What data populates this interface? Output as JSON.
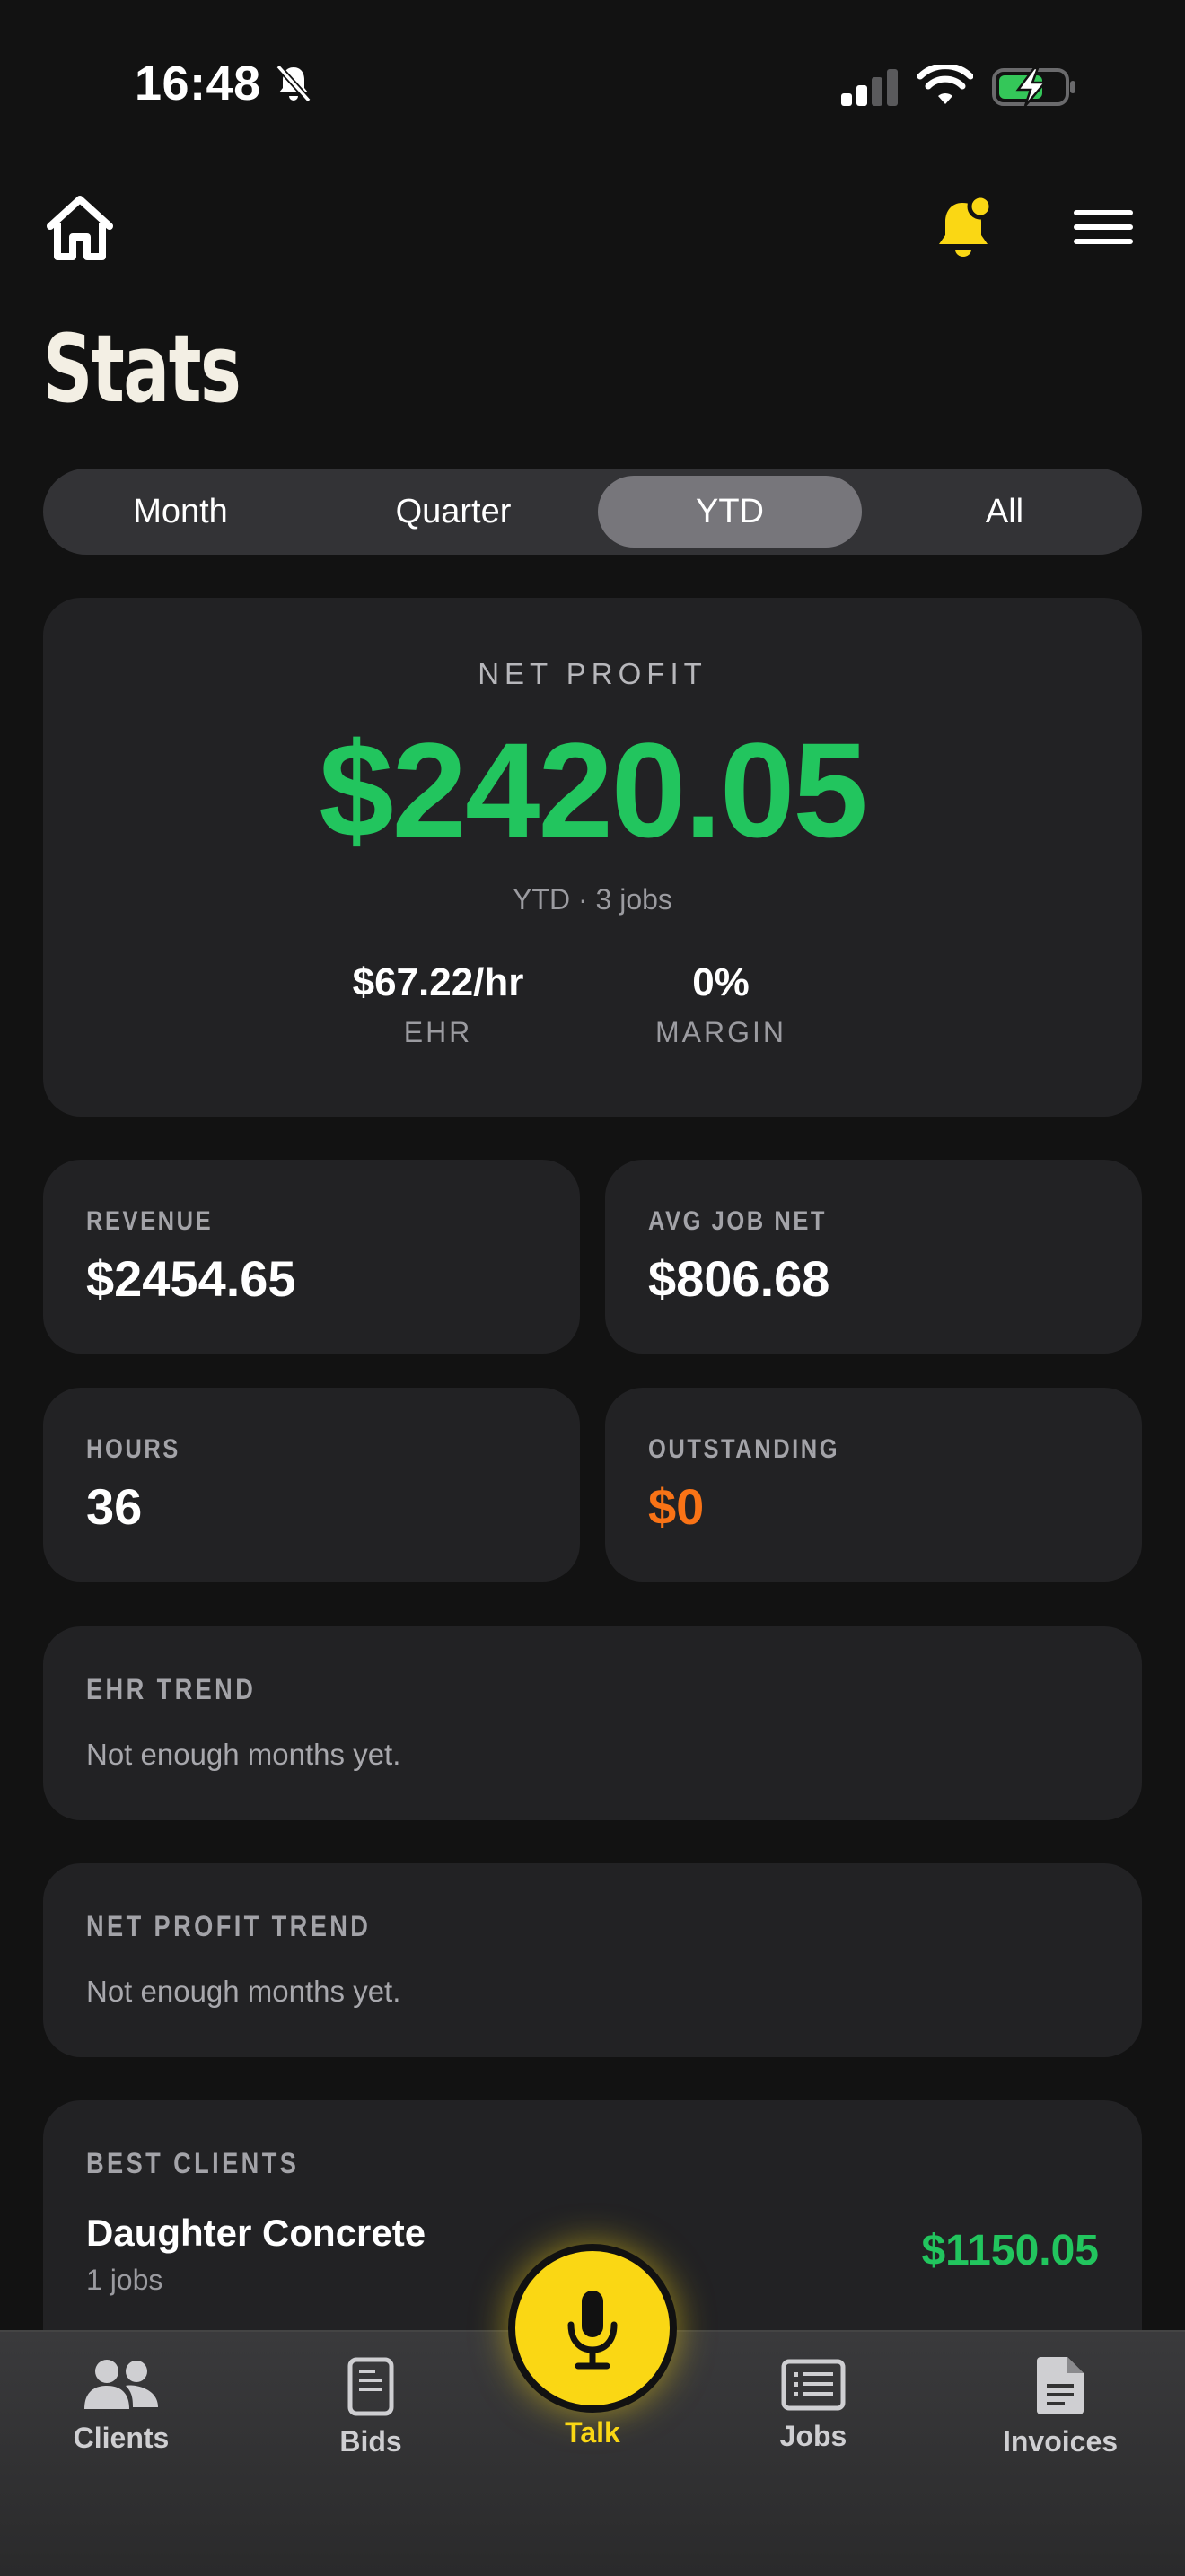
{
  "status_bar": {
    "time": "16:48"
  },
  "header": {
    "title": "Stats"
  },
  "period_tabs": [
    "Month",
    "Quarter",
    "YTD",
    "All"
  ],
  "active_period": "YTD",
  "net_profit": {
    "label": "NET PROFIT",
    "value": "$2420.05",
    "subtitle": "YTD · 3 jobs",
    "ehr_value": "$67.22/hr",
    "ehr_label": "EHR",
    "margin_value": "0%",
    "margin_label": "MARGIN"
  },
  "stats": {
    "revenue": {
      "label": "REVENUE",
      "value": "$2454.65"
    },
    "avg_job_net": {
      "label": "AVG JOB NET",
      "value": "$806.68"
    },
    "hours": {
      "label": "HOURS",
      "value": "36"
    },
    "outstanding": {
      "label": "OUTSTANDING",
      "value": "$0"
    }
  },
  "ehr_trend": {
    "label": "EHR TREND",
    "text": "Not enough months yet."
  },
  "net_profit_trend": {
    "label": "NET PROFIT TREND",
    "text": "Not enough months yet."
  },
  "best_clients": {
    "label": "BEST CLIENTS",
    "items": [
      {
        "name": "Daughter Concrete",
        "jobs": "1 jobs",
        "amount": "$1150.05"
      }
    ]
  },
  "tabbar": {
    "clients": "Clients",
    "bids": "Bids",
    "talk": "Talk",
    "jobs": "Jobs",
    "invoices": "Invoices"
  },
  "colors": {
    "accent_yellow": "#fad714",
    "profit_green": "#22c55e",
    "outstanding_orange": "#f97316",
    "background": "#121212",
    "card": "#222224"
  },
  "icons": [
    "bell-off-icon",
    "signal-icon",
    "wifi-icon",
    "battery-charging-icon",
    "home-icon",
    "notification-bell-icon",
    "menu-icon",
    "clients-icon",
    "bids-icon",
    "microphone-icon",
    "jobs-icon",
    "invoices-icon"
  ]
}
